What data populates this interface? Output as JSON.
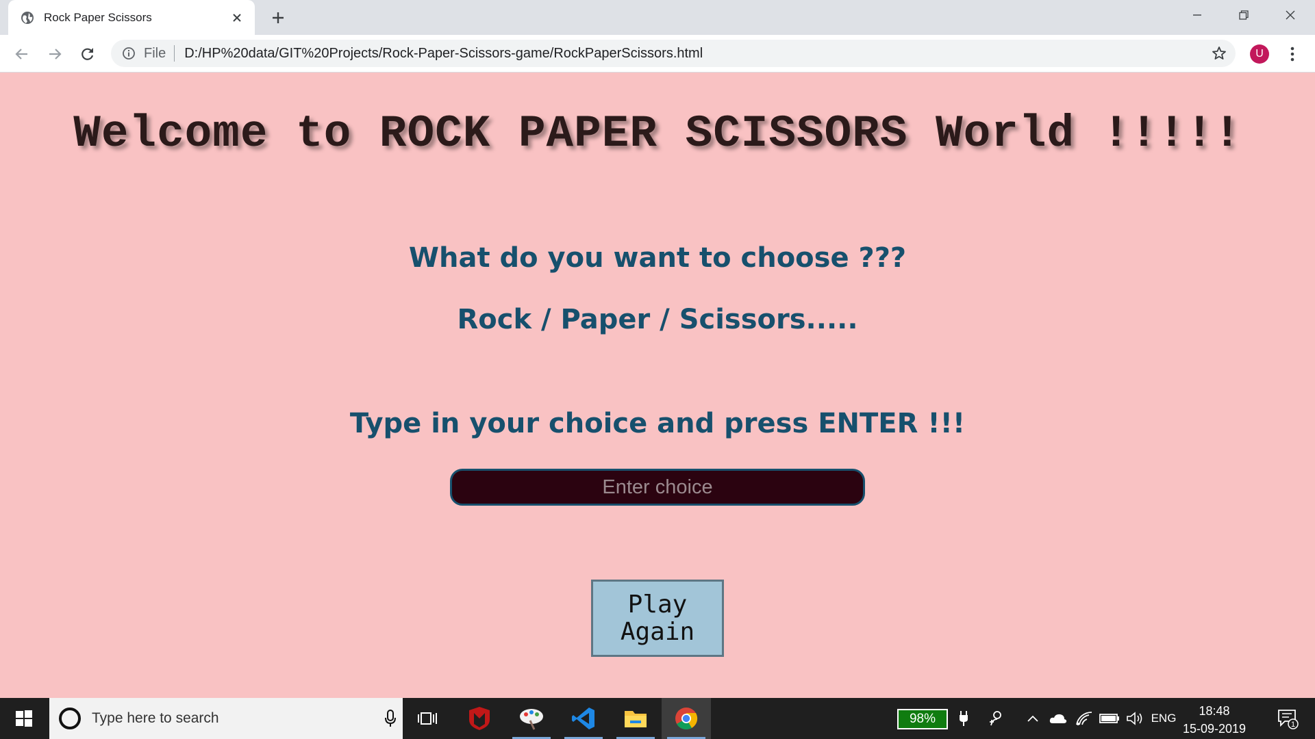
{
  "browser": {
    "tab_title": "Rock Paper Scissors",
    "address_scheme": "File",
    "address_url": "D:/HP%20data/GIT%20Projects/Rock-Paper-Scissors-game/RockPaperScissors.html",
    "profile_initial": "U",
    "profile_color": "#c2185b"
  },
  "page": {
    "background": "#f9c2c3",
    "heading": "Welcome to ROCK PAPER SCISSORS World !!!!!",
    "question": "What do you want to choose ???",
    "options_line": "Rock / Paper / Scissors.....",
    "instruction": "Type in your choice and press ENTER !!!",
    "choice_input": {
      "placeholder": "Enter choice",
      "value": ""
    },
    "play_again_label": "Play\nAgain"
  },
  "taskbar": {
    "search_placeholder": "Type here to search",
    "battery_percent": "98%",
    "language": "ENG",
    "time": "18:48",
    "date": "15-09-2019",
    "notification_count": "1",
    "pinned_apps": [
      "task-view",
      "mcafee",
      "paint",
      "vscode",
      "file-explorer",
      "chrome"
    ]
  }
}
